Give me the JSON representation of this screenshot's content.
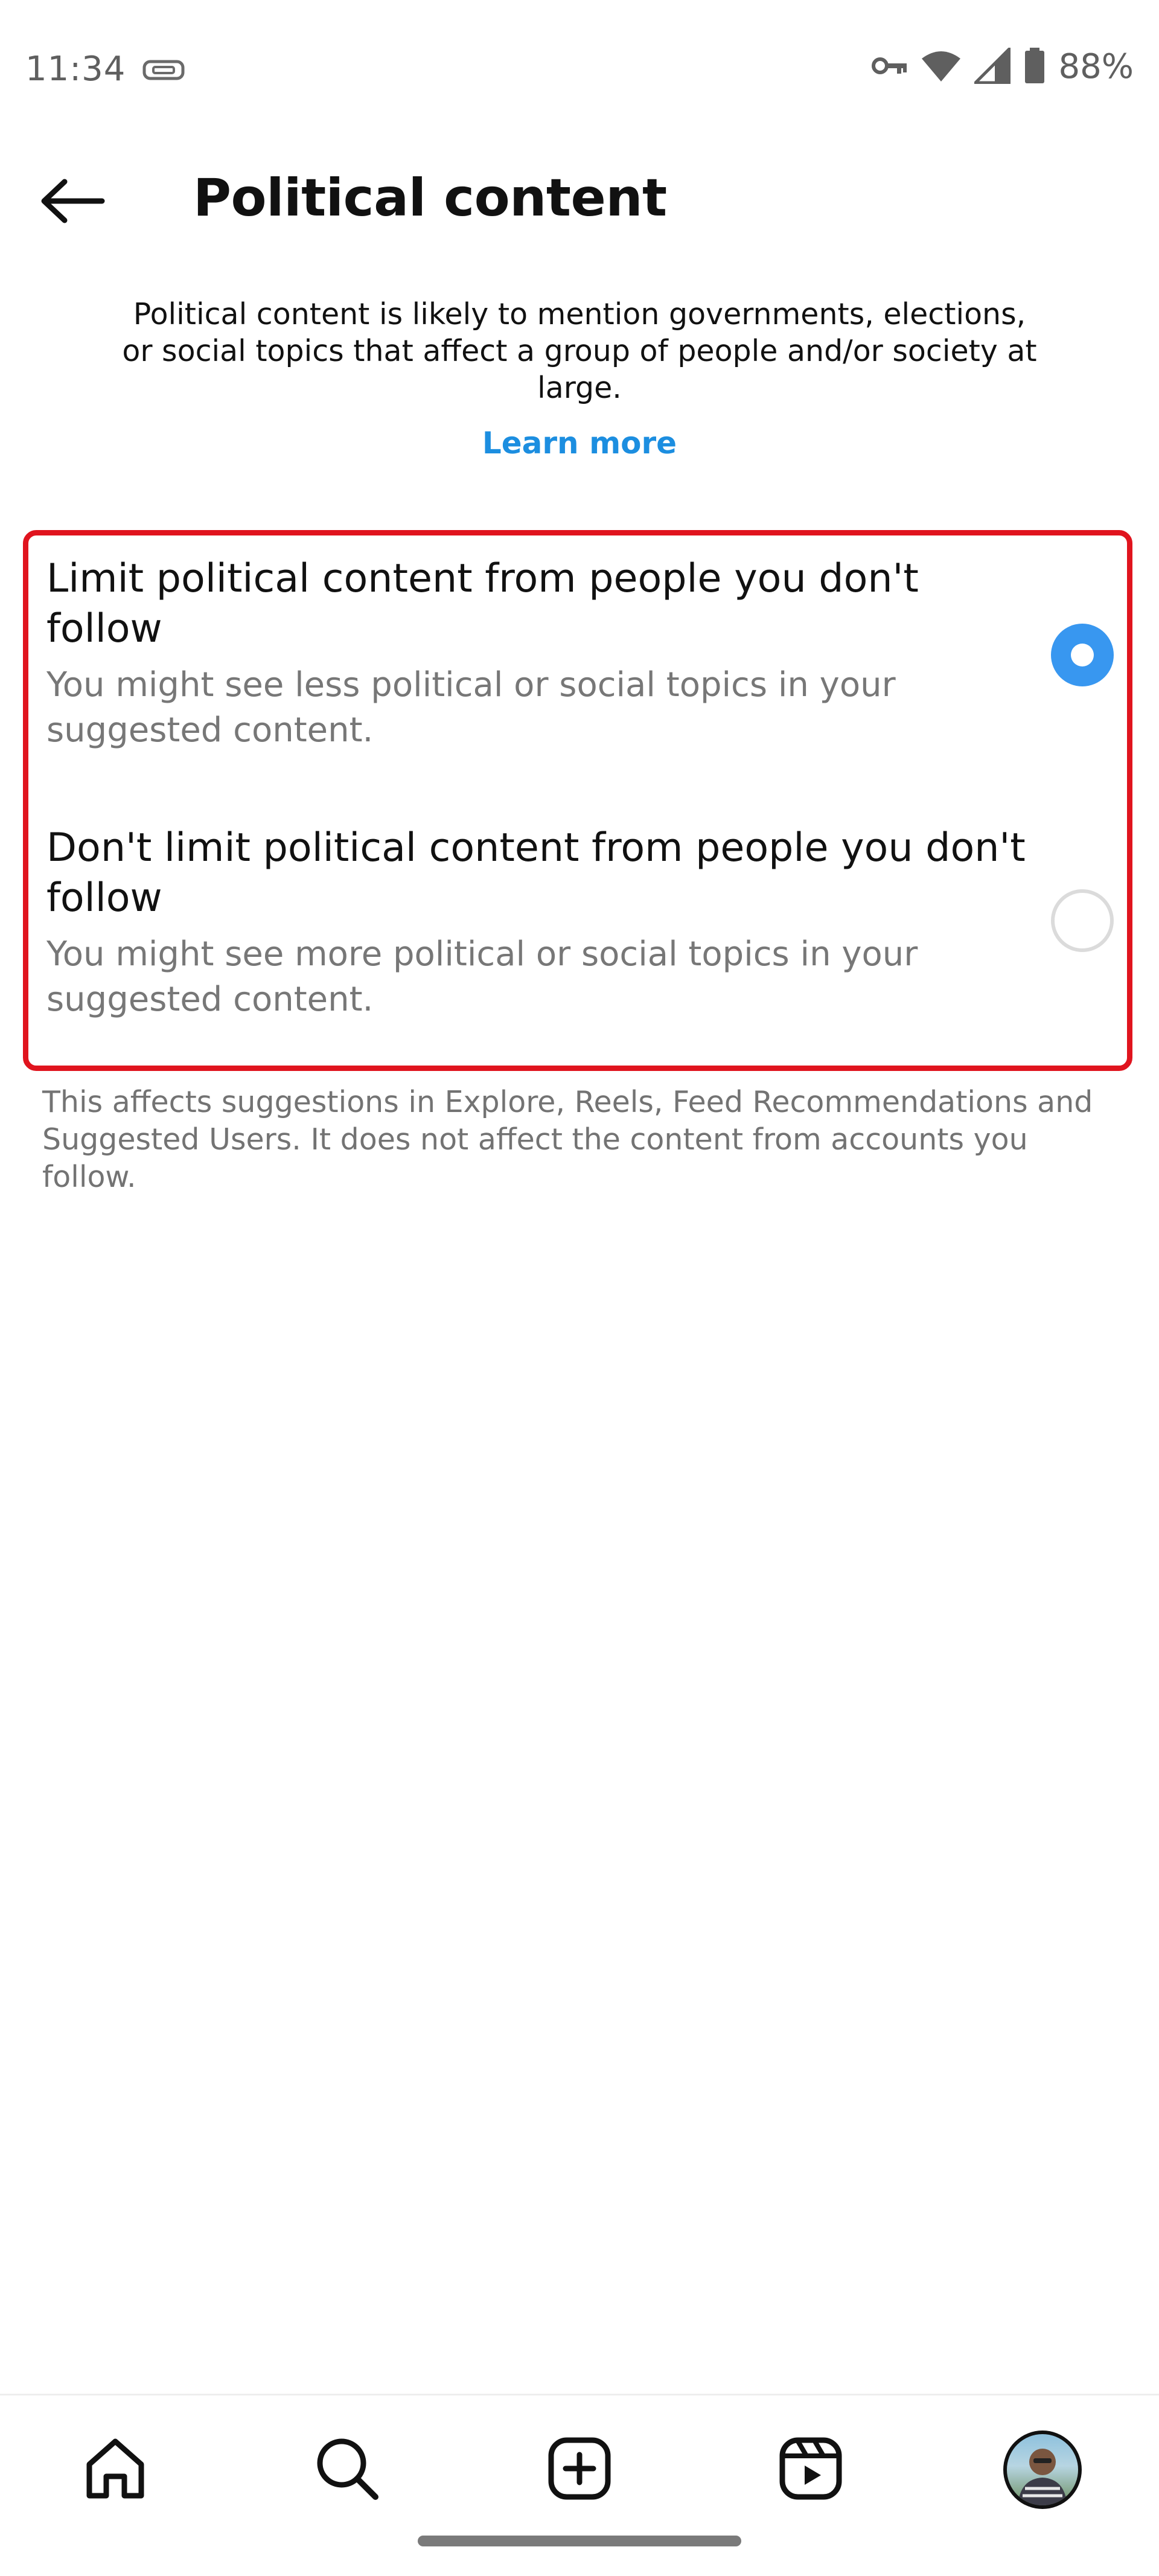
{
  "status_bar": {
    "time": "11:34",
    "battery": "88%",
    "icons": [
      "notification-icon",
      "vpn-key-icon",
      "wifi-icon",
      "signal-icon",
      "battery-icon"
    ]
  },
  "header": {
    "back_icon": "arrow-left-icon",
    "title": "Political content"
  },
  "description": "Political content is likely to mention governments, elections, or social topics that affect a group of people and/or society at large.",
  "learn_more": "Learn more",
  "options": [
    {
      "title": "Limit political content from people you don't follow",
      "description": "You might see less political or social topics in your suggested content.",
      "selected": true
    },
    {
      "title": "Don't limit political content from people you don't follow",
      "description": "You might see more political or social topics in your suggested content.",
      "selected": false
    }
  ],
  "footnote": "This affects suggestions in Explore, Reels, Feed Recommendations and Suggested Users. It does not affect the content from accounts you follow.",
  "bottom_nav": {
    "items": [
      "home-icon",
      "search-icon",
      "create-icon",
      "reels-icon",
      "profile-avatar"
    ]
  },
  "colors": {
    "accent": "#3897f0",
    "link": "#1c8ee0",
    "highlight_border": "#e0141e",
    "secondary_text": "#777777"
  }
}
